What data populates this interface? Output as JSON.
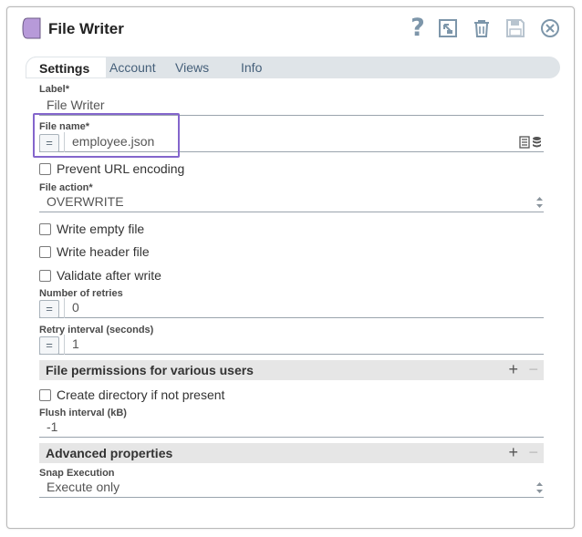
{
  "header": {
    "title": "File Writer",
    "help_label": "?"
  },
  "tabs": [
    {
      "label": "Settings",
      "active": true
    },
    {
      "label": "Account",
      "active": false
    },
    {
      "label": "Views",
      "active": false
    },
    {
      "label": "Info",
      "active": false
    }
  ],
  "form": {
    "label_label": "Label*",
    "label_value": "File Writer",
    "filename_label": "File name*",
    "filename_expr": "=",
    "filename_value": "employee.json",
    "prevent_url_label": "Prevent URL encoding",
    "file_action_label": "File action*",
    "file_action_value": "OVERWRITE",
    "write_empty_label": "Write empty file",
    "write_header_label": "Write header file",
    "validate_label": "Validate after write",
    "retries_label": "Number of retries",
    "retries_expr": "=",
    "retries_value": "0",
    "retry_interval_label": "Retry interval (seconds)",
    "retry_interval_expr": "=",
    "retry_interval_value": "1",
    "permissions_section": "File permissions for various users",
    "create_dir_label": "Create directory if not present",
    "flush_label": "Flush interval (kB)",
    "flush_value": "-1",
    "advanced_section": "Advanced properties",
    "snap_exec_label": "Snap Execution",
    "snap_exec_value": "Execute only",
    "plus": "+",
    "minus": "−"
  },
  "colors": {
    "accent_highlight": "#8466cc",
    "snap_icon": "#b79ad9",
    "tab_bar": "#dfe4e8",
    "icon_gray": "#7d96aa"
  }
}
